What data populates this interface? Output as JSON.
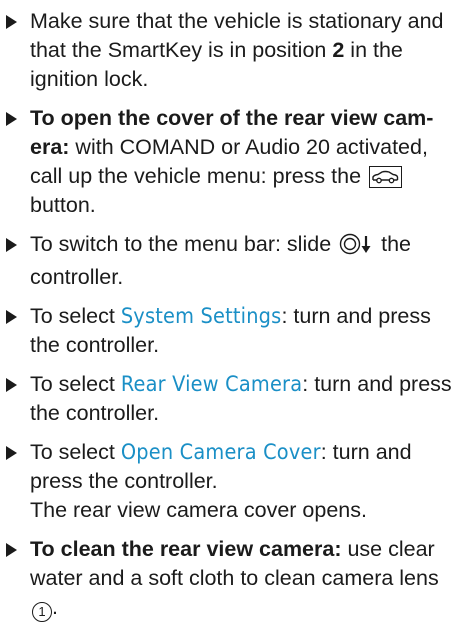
{
  "steps": [
    {
      "text_a": "Make sure that the vehicle is stationary and that the SmartKey is in position ",
      "bold_a": "2",
      "text_b": " in the ignition lock."
    },
    {
      "bold_a": "To open the cover of the rear view cam-era:",
      "text_a": " with COMAND or Audio 20 activated, call up the vehicle menu: press the ",
      "icon": "vehicle-button-icon",
      "text_b": " button."
    },
    {
      "text_a": "To switch to the menu bar: slide ",
      "icon": "controller-slide-down-icon",
      "text_b": " the controller."
    },
    {
      "text_a": "To select ",
      "menu": "System Settings",
      "text_b": ": turn and press the controller."
    },
    {
      "text_a": "To select ",
      "menu": "Rear View Camera",
      "text_b": ": turn and press the controller."
    },
    {
      "text_a": "To select ",
      "menu": "Open Camera Cover",
      "text_b": ": turn and press the controller.",
      "result": "The rear view camera cover opens."
    },
    {
      "bold_a": "To clean the rear view camera:",
      "text_a": " use clear water and a soft cloth to clean camera lens ",
      "callout": "1",
      "text_b": "."
    }
  ],
  "colors": {
    "text": "#1b1b1b",
    "menu_item": "#1a8fc6"
  }
}
